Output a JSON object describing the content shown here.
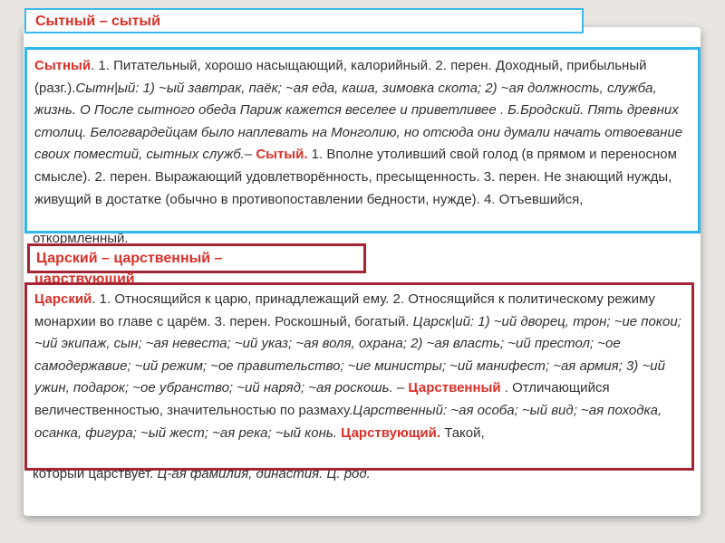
{
  "title": "Сытный – сытый",
  "box1": {
    "w1": "Сытный",
    "t1": ". 1. Питательный, хорошо насыщающий, калорийный. 2. перен. Доходный, прибыльный (разг.).",
    "e1": "Сытн|ый: 1) ~ый завтрак, паёк; ~ая еда, каша, зимовка скота; 2) ~ая должность, служба, жизнь. О После сытного обеда Париж кажется веселее и приветливее . Б.Бродский. Пять древних столиц. Белогвардейцам было наплевать на Монголию, но отсюда они думали начать отвоевание своих поместий, сытных служб.–",
    "w2": "Сытый.",
    "t2": " 1. Вполне утоливший свой голод (в прямом и переносном смысле). 2. перен. Выражающий удовлетворённость, пресыщенность. 3. перен. Не знающий нужды, живущий в достатке (обычно в противопоставлении бедности, нужде). 4. Отъевшийся,",
    "overflow": "откормленный."
  },
  "header2": {
    "line1": "Царский – царственный –",
    "line2": "царствующий"
  },
  "box2": {
    "w1": "Царский",
    "t1": ". 1. Относящийся к царю, принадлежащий ему. 2. Относящийся к политическому режиму монархии во главе с царём. 3. перен. Роскошный, богатый.",
    "e1": "Царск|ий: 1) ~ий дворец, трон; ~ие покои; ~ий экипаж, сын; ~ая невеста; ~ий указ; ~ая воля, охрана; 2) ~ая власть; ~ий престол; ~ое самодержавие; ~ий режим; ~ое правительство; ~ие министры; ~ий манифест; ~ая армия; 3) ~ий ужин, подарок; ~ое убранство; ~ий наряд; ~ая роскошь.",
    "dash": " – ",
    "w2": "Царственный",
    "t2": " . Отличающийся величественностью, значительностью по размаху.",
    "e2": "Царственный: ~ая особа; ~ый вид; ~ая походка, осанка, фигура; ~ый жест; ~ая река; ~ый конь.",
    "w3": "Царствующий.",
    "t3": " Такой,",
    "overflow_plain": "который царствует. ",
    "overflow_italic": "Ц-ая фамилия, династия. Ц. род."
  }
}
